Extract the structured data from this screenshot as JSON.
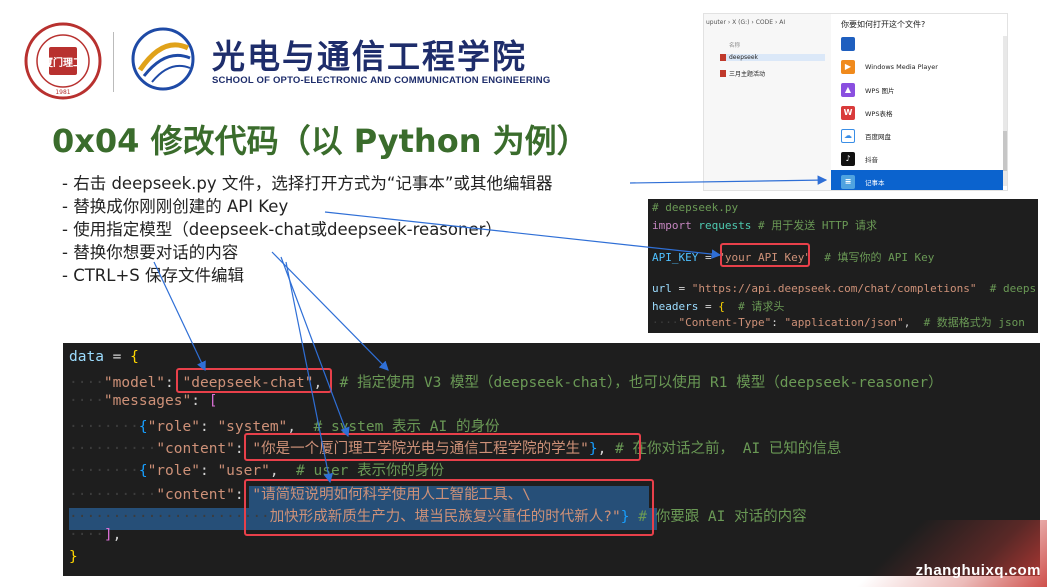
{
  "header": {
    "school_name_cn": "光电与通信工程学院",
    "school_name_en": "SCHOOL OF OPTO-ELECTRONIC AND COMMUNICATION ENGINEERING",
    "seal_text": "XIAMEN UNIVERSITY OF TECHNOLOGY",
    "seal_center": "厦门理工",
    "seal_year": "1981"
  },
  "title": "0x04 修改代码（以 Python 为例）",
  "bullets": [
    "- 右击 deepseek.py 文件，选择打开方式为“记事本”或其他编辑器",
    "- 替换成你刚刚创建的 API Key",
    "- 使用指定模型（deepseek-chat或deepseek-reasoner）",
    "- 替换你想要对话的内容",
    "- CTRL+S 保存文件编辑"
  ],
  "dialog": {
    "breadcrumb": "uputer › X (G:) › CODE › AI",
    "column_header": "名称",
    "files": [
      "deepseek",
      "三月主题活动"
    ],
    "question": "你要如何打开这个文件?",
    "apps": [
      {
        "label": "",
        "icon": "app-icon-top",
        "color": "#1f5fbf"
      },
      {
        "label": "Windows Media Player",
        "icon": "media-player-icon",
        "color": "#f08a1c"
      },
      {
        "label": "WPS 图片",
        "icon": "wps-picture-icon",
        "color": "#8a4fe0"
      },
      {
        "label": "WPS表格",
        "icon": "wps-sheet-icon",
        "color": "#d93b3b"
      },
      {
        "label": "百度网盘",
        "icon": "baidu-netdisk-icon",
        "color": "#3a8ee6"
      },
      {
        "label": "抖音",
        "icon": "douyin-icon",
        "color": "#111111"
      },
      {
        "label": "记事本",
        "icon": "notepad-icon",
        "color": "#4fa3e0",
        "selected": true
      }
    ]
  },
  "editor_right": {
    "lines": {
      "l1": "# deepseek.py",
      "l2_kw": "import",
      "l2_mod": "requests",
      "l2_cm": "# 用于发送 HTTP 请求",
      "l3_var": "API_KEY",
      "l3_eq": " = ",
      "l3_str": "\"your API Key\"",
      "l3_cm": "# 填写你的 API Key",
      "l4_var": "url",
      "l4_str": "\"https://api.deepseek.com/chat/completions\"",
      "l4_cm": "# deeps",
      "l5_var": "headers",
      "l5_cm": "# 请求头",
      "l6_str1": "\"Content-Type\"",
      "l6_str2": "\"application/json\"",
      "l6_cm": "# 数据格式为 json"
    }
  },
  "editor_main": {
    "data_var": "data",
    "model_key": "\"model\"",
    "model_val": "\"deepseek-chat\"",
    "model_cm": "# 指定使用 V3 模型（deepseek-chat），也可以使用 R1 模型（deepseek-reasoner）",
    "messages_key": "\"messages\"",
    "role_key": "\"role\"",
    "role_system": "\"system\"",
    "system_cm": "# system 表示 AI 的身份",
    "content_key": "\"content\"",
    "system_content": "\"你是一个厦门理工学院光电与通信工程学院的学生\"",
    "system_content_cm": "# 在你对话之前， AI 已知的信息",
    "role_user": "\"user\"",
    "user_cm": "# user 表示你的身份",
    "user_content_1": "\"请简短说明如何科学使用人工智能工具、\\",
    "user_content_2": "加快形成新质生产力、堪当民族复兴重任的时代新人?\"",
    "user_content_cm": "# 你要跟 AI 对话的内容"
  },
  "watermark": "zhanghuixq.com",
  "colors": {
    "title_green": "#3a6c2c",
    "school_blue": "#1e2d6b",
    "highlight_red": "#e8404a",
    "arrow_blue": "#2f6fd6",
    "editor_bg": "#1e1e1e"
  }
}
